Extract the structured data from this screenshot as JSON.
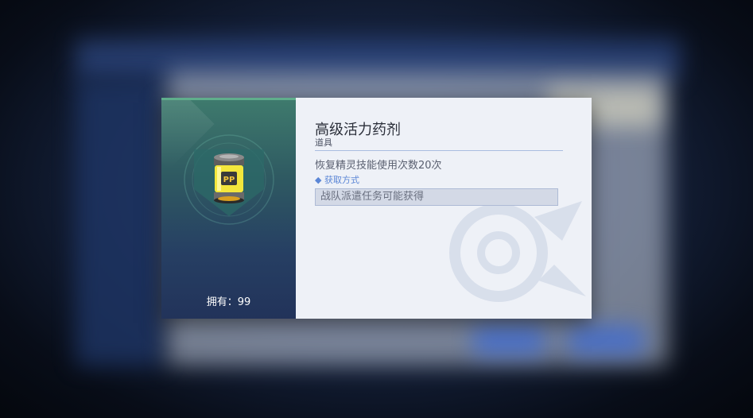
{
  "item": {
    "name": "高级活力药剂",
    "category": "道具",
    "description": "恢复精灵技能使用次数20次",
    "icon": "pp-potion-icon",
    "icon_label": "PP",
    "owned_label": "拥有：99"
  },
  "source": {
    "header": "◆ 获取方式",
    "entries": [
      "战队派遣任务可能获得"
    ]
  },
  "colors": {
    "accent_blue": "#5b86d6",
    "panel_left_top": "#3e7a6d",
    "panel_left_bottom": "#22335a",
    "potion_yellow": "#f3e63c"
  }
}
